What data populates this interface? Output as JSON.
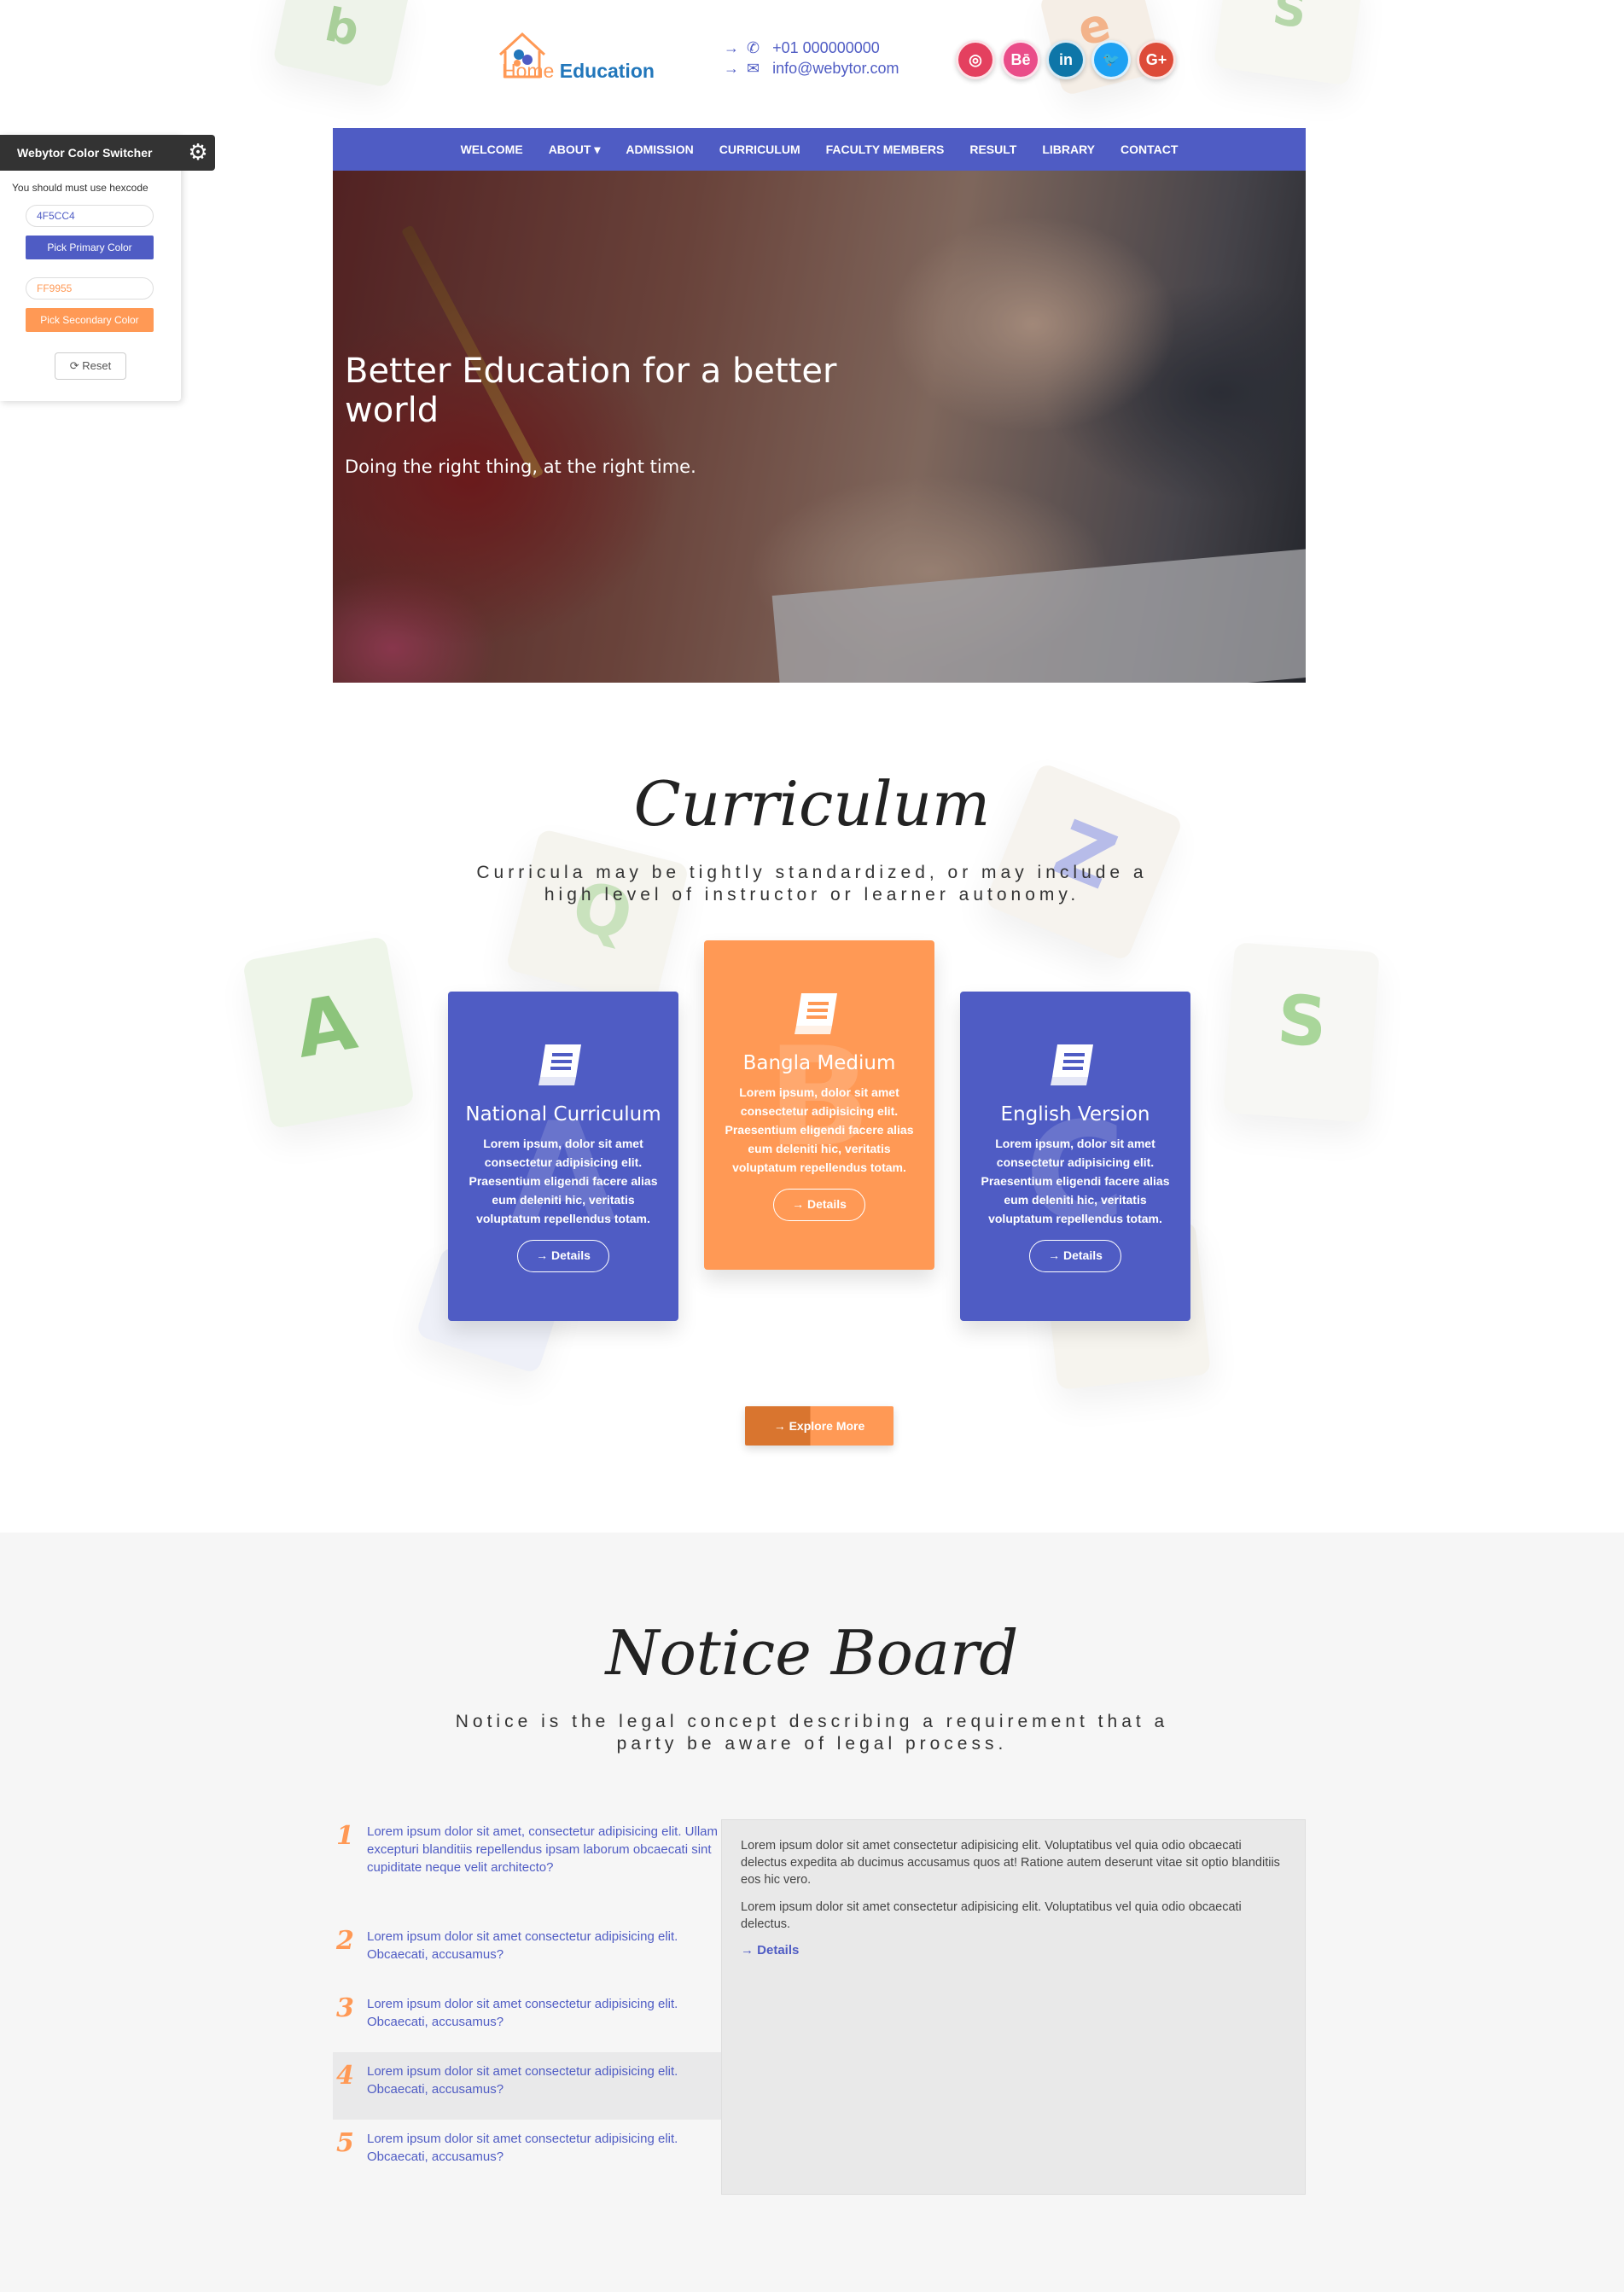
{
  "colors": {
    "primary": "#4F5CC4",
    "secondary": "#FF9955",
    "dark": "#333333"
  },
  "header": {
    "logo": {
      "home": "Home",
      "education": "Education"
    },
    "phone": "+01 000000000",
    "email": "info@webytor.com",
    "arrow": "→",
    "social": [
      {
        "name": "instagram",
        "glyph": "◎",
        "color": "#e4405f"
      },
      {
        "name": "behance",
        "glyph": "Bē",
        "color": "#ea4c89"
      },
      {
        "name": "linkedin",
        "glyph": "in",
        "color": "#0e76a8"
      },
      {
        "name": "twitter",
        "glyph": "🐦",
        "color": "#1da1f2"
      },
      {
        "name": "google-plus",
        "glyph": "G+",
        "color": "#dd4b39"
      }
    ]
  },
  "nav": {
    "items": [
      "WELCOME",
      "ABOUT ▾",
      "ADMISSION",
      "CURRICULUM",
      "FACULTY MEMBERS",
      "RESULT",
      "LIBRARY",
      "CONTACT"
    ]
  },
  "hero": {
    "title": "Better Education for a better world",
    "subtitle": "Doing the right thing, at the right time."
  },
  "switcher": {
    "title": "Webytor Color Switcher",
    "note": "You should must use hexcode",
    "primary_value": "4F5CC4",
    "primary_button": "Pick Primary Color",
    "secondary_value": "FF9955",
    "secondary_button": "Pick Secondary Color",
    "reset": "⟳ Reset"
  },
  "curriculum": {
    "title": "Curriculum",
    "subtitle": "Curricula may be tightly standardized, or may include a high level of instructor or learner autonomy.",
    "cards": [
      {
        "title": "National Curriculum",
        "watermark": "A",
        "text": "Lorem ipsum, dolor sit amet consectetur adipisicing elit. Praesentium eligendi facere alias eum deleniti hic, veritatis voluptatum repellendus totam.",
        "button": "→ Details",
        "color": "#4F5CC4"
      },
      {
        "title": "Bangla Medium",
        "watermark": "B",
        "text": "Lorem ipsum, dolor sit amet consectetur adipisicing elit. Praesentium eligendi facere alias eum deleniti hic, veritatis voluptatum repellendus totam.",
        "button": "→ Details",
        "color": "#FF9955"
      },
      {
        "title": "English Version",
        "watermark": "C",
        "text": "Lorem ipsum, dolor sit amet consectetur adipisicing elit. Praesentium eligendi facere alias eum deleniti hic, veritatis voluptatum repellendus totam.",
        "button": "→ Details",
        "color": "#4F5CC4"
      }
    ],
    "explore": "→ Explore More"
  },
  "notice": {
    "title": "Notice Board",
    "subtitle": "Notice is the legal concept describing a requirement that a party be aware of legal process.",
    "items": [
      {
        "num": "1",
        "text": "Lorem ipsum dolor sit amet, consectetur adipisicing elit. Ullam excepturi blanditiis repellendus ipsam laborum obcaecati sint cupiditate neque velit architecto?"
      },
      {
        "num": "2",
        "text": "Lorem ipsum dolor sit amet consectetur adipisicing elit. Obcaecati, accusamus?"
      },
      {
        "num": "3",
        "text": "Lorem ipsum dolor sit amet consectetur adipisicing elit. Obcaecati, accusamus?"
      },
      {
        "num": "4",
        "text": "Lorem ipsum dolor sit amet consectetur adipisicing elit. Obcaecati, accusamus?"
      },
      {
        "num": "5",
        "text": "Lorem ipsum dolor sit amet consectetur adipisicing elit. Obcaecati, accusamus?"
      }
    ],
    "active_index": 3,
    "panel": {
      "p1": "Lorem ipsum dolor sit amet consectetur adipisicing elit. Voluptatibus vel quia odio obcaecati delectus expedita ab ducimus accusamus quos at! Ratione autem deserunt vitae sit optio blanditiis eos hic vero.",
      "p2": "Lorem ipsum dolor sit amet consectetur adipisicing elit. Voluptatibus vel quia odio obcaecati delectus.",
      "link": "→ Details"
    }
  }
}
